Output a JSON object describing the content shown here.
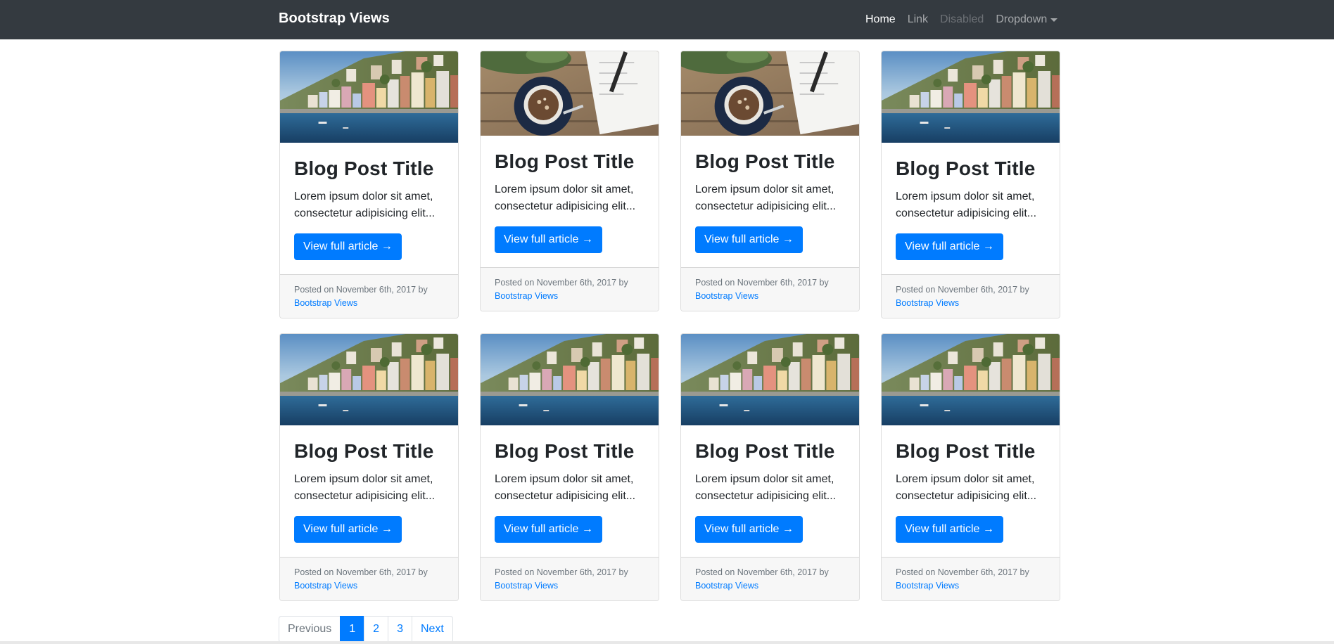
{
  "navbar": {
    "brand": "Bootstrap Views",
    "links": [
      {
        "label": "Home",
        "state": "active"
      },
      {
        "label": "Link",
        "state": "normal"
      },
      {
        "label": "Disabled",
        "state": "disabled"
      },
      {
        "label": "Dropdown",
        "state": "dropdown"
      }
    ]
  },
  "colors": {
    "navbar_bg": "#343a40",
    "primary": "#007bff",
    "footer_bg": "#f7f7f7"
  },
  "posts": [
    {
      "image": "harbor-town-photo",
      "title": "Blog Post Title",
      "excerpt": "Lorem ipsum dolor sit amet, consectetur adipisicing elit...",
      "button": "View full article →",
      "posted": "Posted on November 6th, 2017 by",
      "author": "Bootstrap Views"
    },
    {
      "image": "coffee-notebook-photo",
      "title": "Blog Post Title",
      "excerpt": "Lorem ipsum dolor sit amet, consectetur adipisicing elit...",
      "button": "View full article →",
      "posted": "Posted on November 6th, 2017 by",
      "author": "Bootstrap Views"
    },
    {
      "image": "coffee-notebook-photo",
      "title": "Blog Post Title",
      "excerpt": "Lorem ipsum dolor sit amet, consectetur adipisicing elit...",
      "button": "View full article →",
      "posted": "Posted on November 6th, 2017 by",
      "author": "Bootstrap Views"
    },
    {
      "image": "harbor-town-photo",
      "title": "Blog Post Title",
      "excerpt": "Lorem ipsum dolor sit amet, consectetur adipisicing elit...",
      "button": "View full article →",
      "posted": "Posted on November 6th, 2017 by",
      "author": "Bootstrap Views"
    },
    {
      "image": "harbor-town-photo",
      "title": "Blog Post Title",
      "excerpt": "Lorem ipsum dolor sit amet, consectetur adipisicing elit...",
      "button": "View full article →",
      "posted": "Posted on November 6th, 2017 by",
      "author": "Bootstrap Views"
    },
    {
      "image": "harbor-town-photo",
      "title": "Blog Post Title",
      "excerpt": "Lorem ipsum dolor sit amet, consectetur adipisicing elit...",
      "button": "View full article →",
      "posted": "Posted on November 6th, 2017 by",
      "author": "Bootstrap Views"
    },
    {
      "image": "harbor-town-photo",
      "title": "Blog Post Title",
      "excerpt": "Lorem ipsum dolor sit amet, consectetur adipisicing elit...",
      "button": "View full article →",
      "posted": "Posted on November 6th, 2017 by",
      "author": "Bootstrap Views"
    },
    {
      "image": "harbor-town-photo",
      "title": "Blog Post Title",
      "excerpt": "Lorem ipsum dolor sit amet, consectetur adipisicing elit...",
      "button": "View full article →",
      "posted": "Posted on November 6th, 2017 by",
      "author": "Bootstrap Views"
    }
  ],
  "pagination": {
    "previous": "Previous",
    "pages": [
      "1",
      "2",
      "3"
    ],
    "current": "1",
    "next": "Next"
  }
}
